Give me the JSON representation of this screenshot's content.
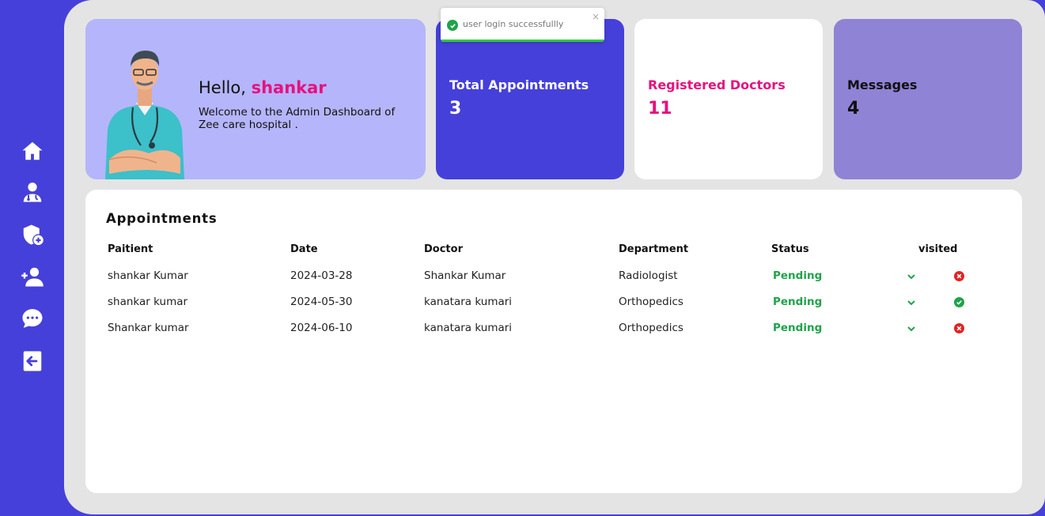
{
  "sidebar": {
    "items": [
      {
        "name": "home",
        "icon": "home-icon"
      },
      {
        "name": "doctors",
        "icon": "user-doctor-icon"
      },
      {
        "name": "add-admin",
        "icon": "shield-plus-icon"
      },
      {
        "name": "add-doctor",
        "icon": "user-plus-icon"
      },
      {
        "name": "messages",
        "icon": "chat-bubble-icon"
      },
      {
        "name": "logout",
        "icon": "logout-icon"
      }
    ]
  },
  "hero": {
    "greeting": "Hello,",
    "user_name": "shankar",
    "welcome_text": "Welcome to the Admin Dashboard of Zee care hospital ."
  },
  "stats": {
    "appointments": {
      "label": "Total Appointments",
      "value": "3"
    },
    "doctors": {
      "label": "Registered Doctors",
      "value": "11"
    },
    "messages": {
      "label": "Messages",
      "value": "4"
    }
  },
  "appointments": {
    "title": "Appointments",
    "columns": [
      "Paitient",
      "Date",
      "Doctor",
      "Department",
      "Status",
      "visited"
    ],
    "rows": [
      {
        "patient": "shankar Kumar",
        "date": "2024-03-28",
        "doctor": "Shankar Kumar",
        "department": "Radiologist",
        "status": "Pending",
        "visited": false
      },
      {
        "patient": "shankar kumar",
        "date": "2024-05-30",
        "doctor": "kanatara kumari",
        "department": "Orthopedics",
        "status": "Pending",
        "visited": true
      },
      {
        "patient": "Shankar kumar",
        "date": "2024-06-10",
        "doctor": "kanatara kumari",
        "department": "Orthopedics",
        "status": "Pending",
        "visited": false
      }
    ]
  },
  "toast": {
    "message": "user login successfullly",
    "close_glyph": "×",
    "progress": 1.0
  },
  "colors": {
    "primary": "#4540d9",
    "accent": "#e6117f",
    "hero_bg": "#b5b5fb",
    "messages_bg": "#8f83d5",
    "status_green": "#1fa34a",
    "status_red": "#e02424"
  }
}
